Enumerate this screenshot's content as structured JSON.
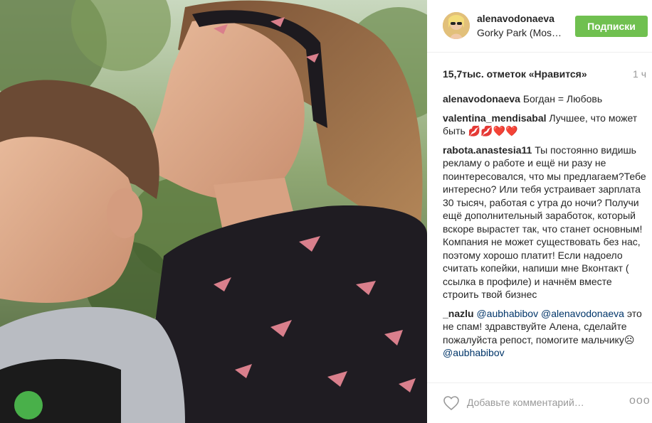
{
  "post": {
    "username": "alenavodonaeva",
    "location": "Gorky Park (Mos…",
    "follow_label": "Подписки",
    "likes": "15,7тыс. отметок «Нравится»",
    "time_ago": "1 ч",
    "accent_color": "#70c050"
  },
  "comments": [
    {
      "user": "alenavodonaeva",
      "text": "Богдан = Любовь",
      "mentions": []
    },
    {
      "user": "valentina_mendisabal",
      "text": "Лучшее, что может быть 💋💋❤️❤️",
      "mentions": []
    },
    {
      "user": "rabota.anastesia11",
      "text": "Ты постоянно видишь рекламу о работе и ещё ни разу не поинтересовался, что мы предлагаем?Тебе интересно? Или тебя устраивает зарплата 30 тысяч, работая с утра до ночи? Получи ещё дополнительный заработок, который вскоре вырастет так, что станет основным! Компания не может существовать без нас, поэтому хорошо платит! Если надоело считать копейки, напиши мне Вконтакт ( ссылка в профиле) и начнём вместе строить твой бизнес",
      "mentions": []
    },
    {
      "user": "_nazlu",
      "mention1": "@aubhabibov",
      "mention2": "@alenavodonaeva",
      "text": "это не спам! здравствуйте Алена, сделайте пожалуйста репост, помогите мальчику☹",
      "mention3": "@aubhabibov"
    }
  ],
  "footer": {
    "placeholder": "Добавьте комментарий…",
    "more_label": "ooo"
  },
  "icons": {
    "heart": "heart-outline-icon",
    "more": "more-options-icon"
  }
}
